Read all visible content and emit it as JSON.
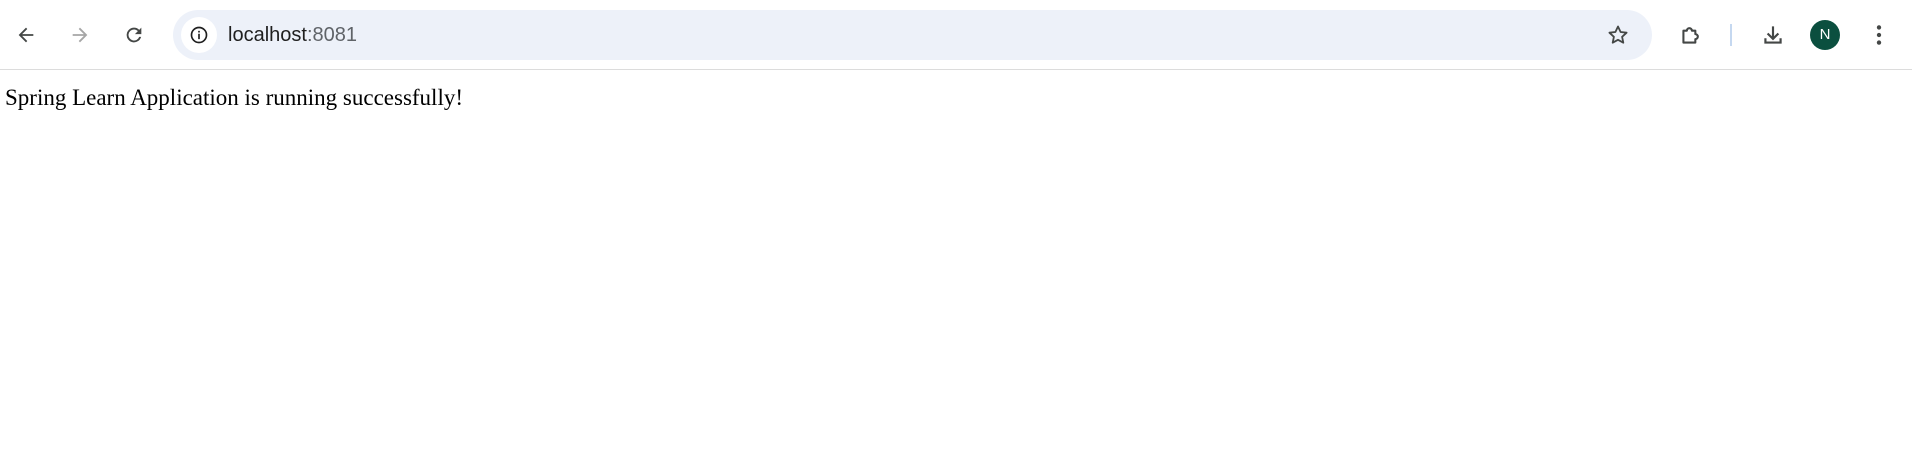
{
  "browser": {
    "address_bar": {
      "host": "localhost",
      "port": ":8081"
    },
    "profile_initial": "N",
    "icons": {
      "back": "arrow-left-icon",
      "forward": "arrow-right-icon",
      "reload": "reload-icon",
      "site_info": "info-icon",
      "bookmark": "star-icon",
      "extensions": "puzzle-icon",
      "downloads": "download-icon",
      "menu": "kebab-menu-icon"
    },
    "colors": {
      "omnibox_bg": "#edf1f9",
      "avatar_bg": "#0b4f3f",
      "icon": "#444746",
      "icon_disabled": "#a6a6a6"
    }
  },
  "page": {
    "body_text": "Spring Learn Application is running successfully!"
  }
}
